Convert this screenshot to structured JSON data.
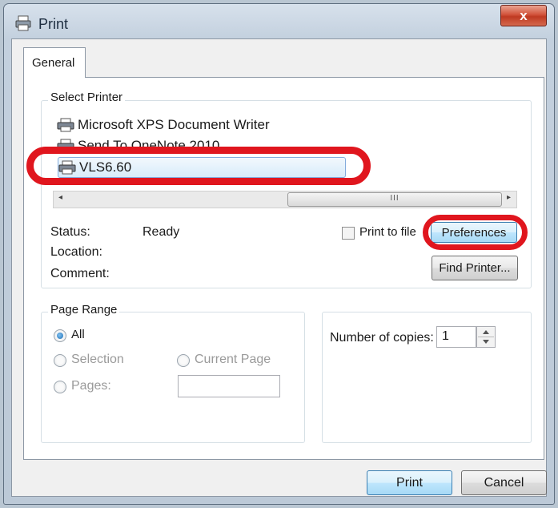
{
  "window": {
    "title": "Print",
    "close_glyph": "x"
  },
  "tabs": [
    {
      "label": "General"
    }
  ],
  "select_printer": {
    "label": "Select Printer",
    "printers": [
      {
        "name": "Microsoft XPS Document Writer",
        "icon": "printer-icon"
      },
      {
        "name": "Send To OneNote 2010",
        "icon": "printer-icon"
      },
      {
        "name": "VLS6.60",
        "icon": "printer-icon",
        "selected": true
      }
    ],
    "scrollbar": {
      "left_arrow": "◂",
      "right_arrow": "▸",
      "grip": "III"
    }
  },
  "status": {
    "status_label": "Status:",
    "status_value": "Ready",
    "location_label": "Location:",
    "location_value": "",
    "comment_label": "Comment:",
    "comment_value": ""
  },
  "print_to_file": {
    "label": "Print to file",
    "checked": false
  },
  "buttons": {
    "preferences": "Preferences",
    "find_printer": "Find Printer...",
    "print": "Print",
    "cancel": "Cancel"
  },
  "page_range": {
    "label": "Page Range",
    "all": "All",
    "selection": "Selection",
    "current_page": "Current Page",
    "pages": "Pages:",
    "pages_value": "",
    "selected_option": "All"
  },
  "copies": {
    "label": "Number of copies:",
    "value": "1"
  },
  "colors": {
    "annotation_red": "#e0161e",
    "default_button_border": "#3c7fb1"
  }
}
